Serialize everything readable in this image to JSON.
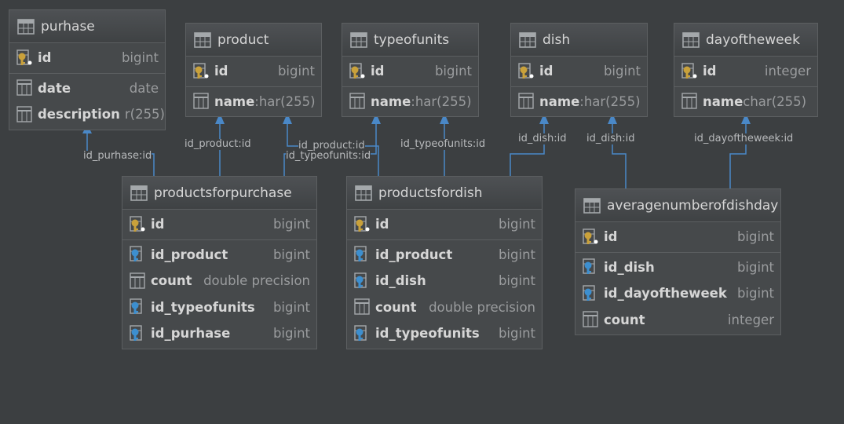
{
  "tables": {
    "purhase": {
      "title": "purhase",
      "rows": [
        {
          "name": "id",
          "type": "bigint"
        },
        {
          "name": "date",
          "type": "date"
        },
        {
          "name": "description",
          "type": "r(255)"
        }
      ]
    },
    "product": {
      "title": "product",
      "rows": [
        {
          "name": "id",
          "type": "bigint"
        },
        {
          "name": "name",
          "type": ":har(255)"
        }
      ]
    },
    "typeofunits": {
      "title": "typeofunits",
      "rows": [
        {
          "name": "id",
          "type": "bigint"
        },
        {
          "name": "name",
          "type": ":har(255)"
        }
      ]
    },
    "dish": {
      "title": "dish",
      "rows": [
        {
          "name": "id",
          "type": "bigint"
        },
        {
          "name": "name",
          "type": ":har(255)"
        }
      ]
    },
    "dayoftheweek": {
      "title": "dayoftheweek",
      "rows": [
        {
          "name": "id",
          "type": "integer"
        },
        {
          "name": "name",
          "type": "char(255)"
        }
      ]
    },
    "productsforpurchase": {
      "title": "productsforpurchase",
      "rows": [
        {
          "name": "id",
          "type": "bigint"
        },
        {
          "name": "id_product",
          "type": "bigint"
        },
        {
          "name": "count",
          "type": "double precision"
        },
        {
          "name": "id_typeofunits",
          "type": "bigint"
        },
        {
          "name": "id_purhase",
          "type": "bigint"
        }
      ]
    },
    "productsfordish": {
      "title": "productsfordish",
      "rows": [
        {
          "name": "id",
          "type": "bigint"
        },
        {
          "name": "id_product",
          "type": "bigint"
        },
        {
          "name": "id_dish",
          "type": "bigint"
        },
        {
          "name": "count",
          "type": "double precision"
        },
        {
          "name": "id_typeofunits",
          "type": "bigint"
        }
      ]
    },
    "averagenumberofdishday": {
      "title": "averagenumberofdishday",
      "rows": [
        {
          "name": "id",
          "type": "bigint"
        },
        {
          "name": "id_dish",
          "type": "bigint"
        },
        {
          "name": "id_dayoftheweek",
          "type": "bigint"
        },
        {
          "name": "count",
          "type": "integer"
        }
      ]
    }
  },
  "edge_labels": {
    "purhase": "id_purhase:id",
    "product_a": "id_product:id",
    "product_b": "id_product:id",
    "typeofunits_a": "id_typeofunits:id",
    "typeofunits_b": "id_typeofunits:id",
    "dish_a": "id_dish:id",
    "dish_b": "id_dish:id",
    "dayoftheweek": "id_dayoftheweek:id"
  },
  "colors": {
    "background": "#3c3f41",
    "edge": "#4a88c7",
    "key_gold": "#c9a13b",
    "key_blue": "#3d8fcf",
    "table_icon": "#a4a8ab"
  }
}
